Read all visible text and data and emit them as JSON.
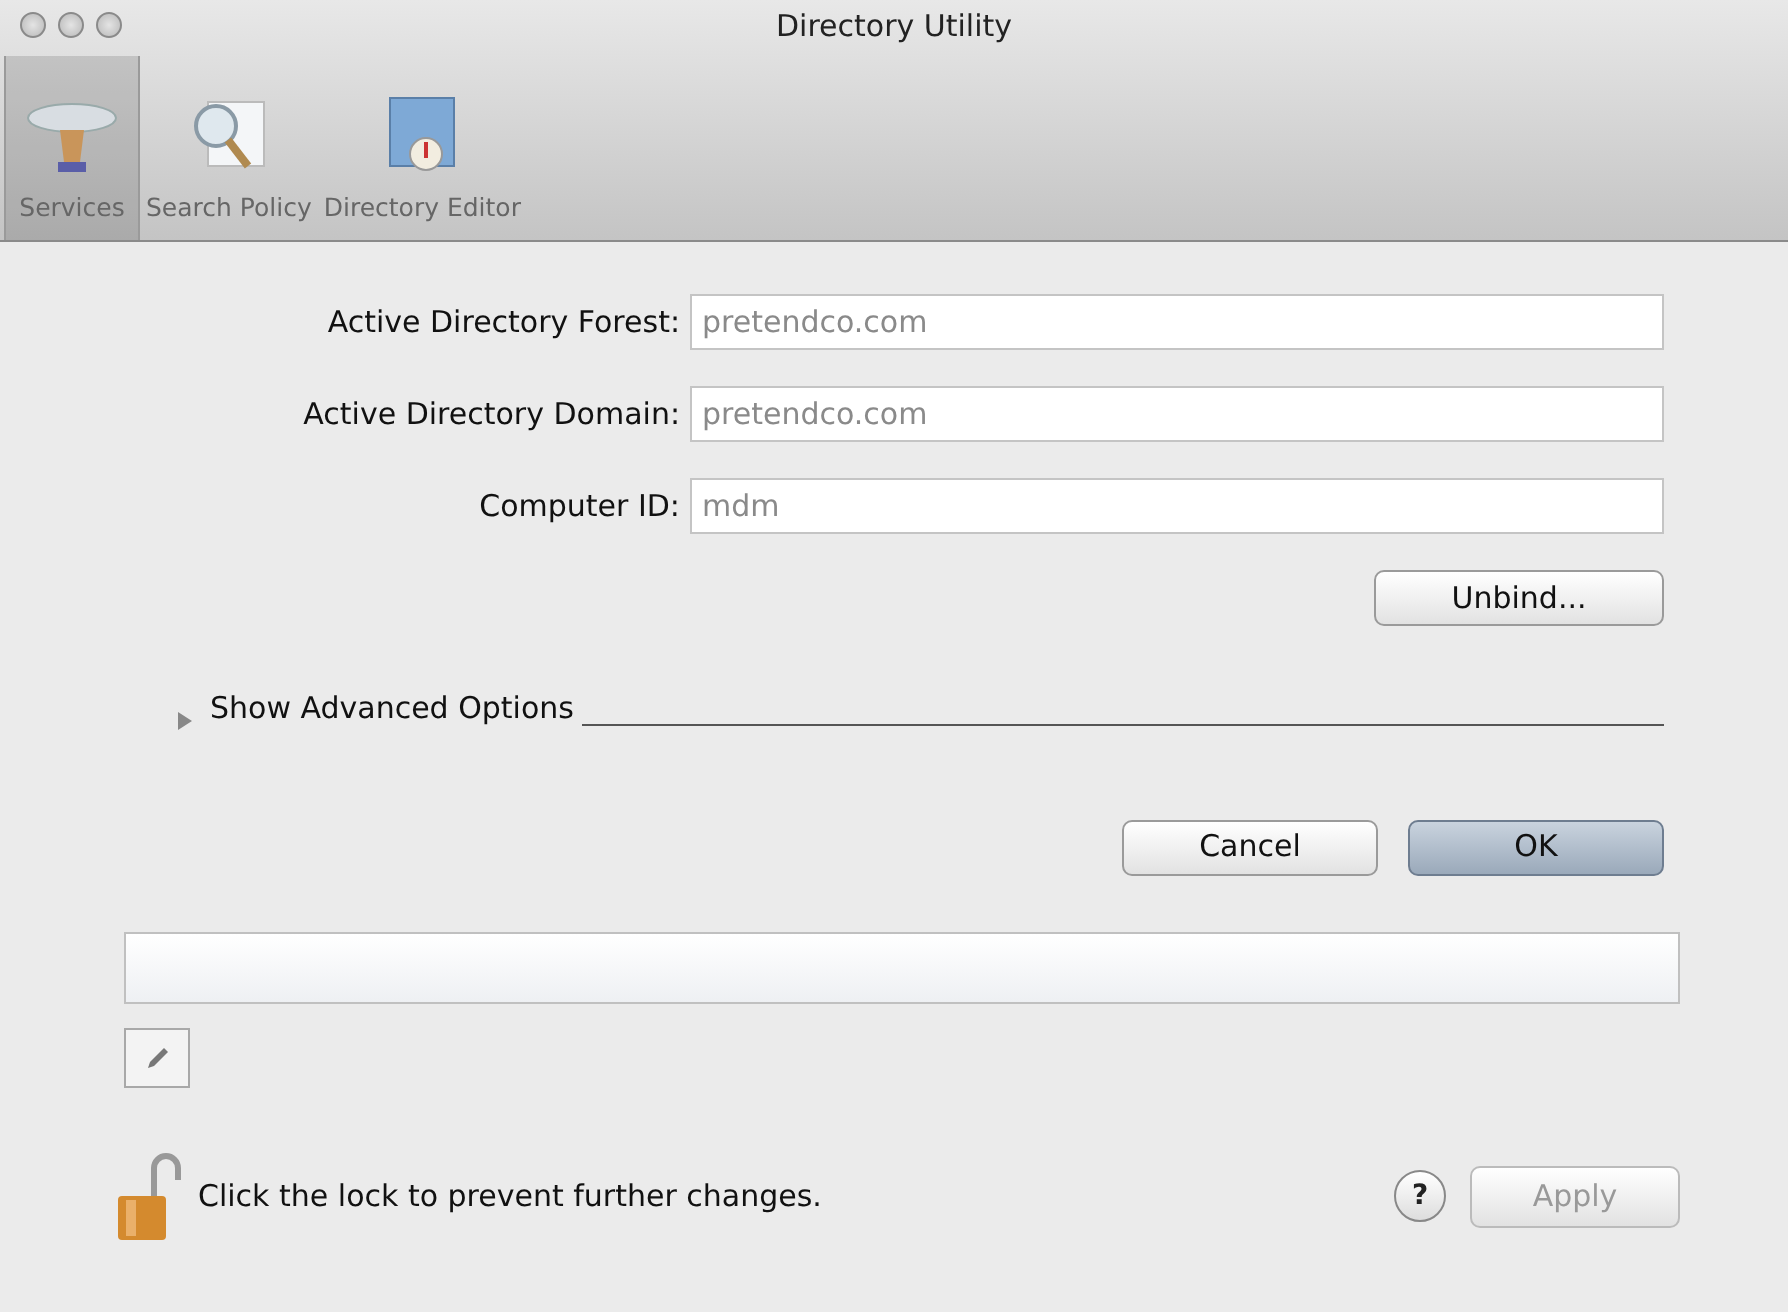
{
  "window": {
    "title": "Directory Utility"
  },
  "tabs": [
    {
      "label": "Services",
      "selected": true
    },
    {
      "label": "Search Policy",
      "selected": false
    },
    {
      "label": "Directory Editor",
      "selected": false
    }
  ],
  "fields": [
    {
      "label": "Active Directory Forest:",
      "value": "pretendco.com",
      "disabled": true
    },
    {
      "label": "Active Directory Domain:",
      "value": "pretendco.com",
      "disabled": true
    },
    {
      "label": "Computer ID:",
      "value": "mdm",
      "disabled": true
    }
  ],
  "unbind_button": {
    "label": "Unbind..."
  },
  "advanced": {
    "label": "Show Advanced Options",
    "expanded": false
  },
  "dialog_buttons": [
    {
      "label": "Cancel",
      "default": false
    },
    {
      "label": "OK",
      "default": true
    }
  ],
  "lock": {
    "text": "Click the lock to prevent further changes.",
    "locked": false
  },
  "help_button": {
    "label": "?"
  },
  "apply_button": {
    "label": "Apply",
    "disabled": true
  }
}
